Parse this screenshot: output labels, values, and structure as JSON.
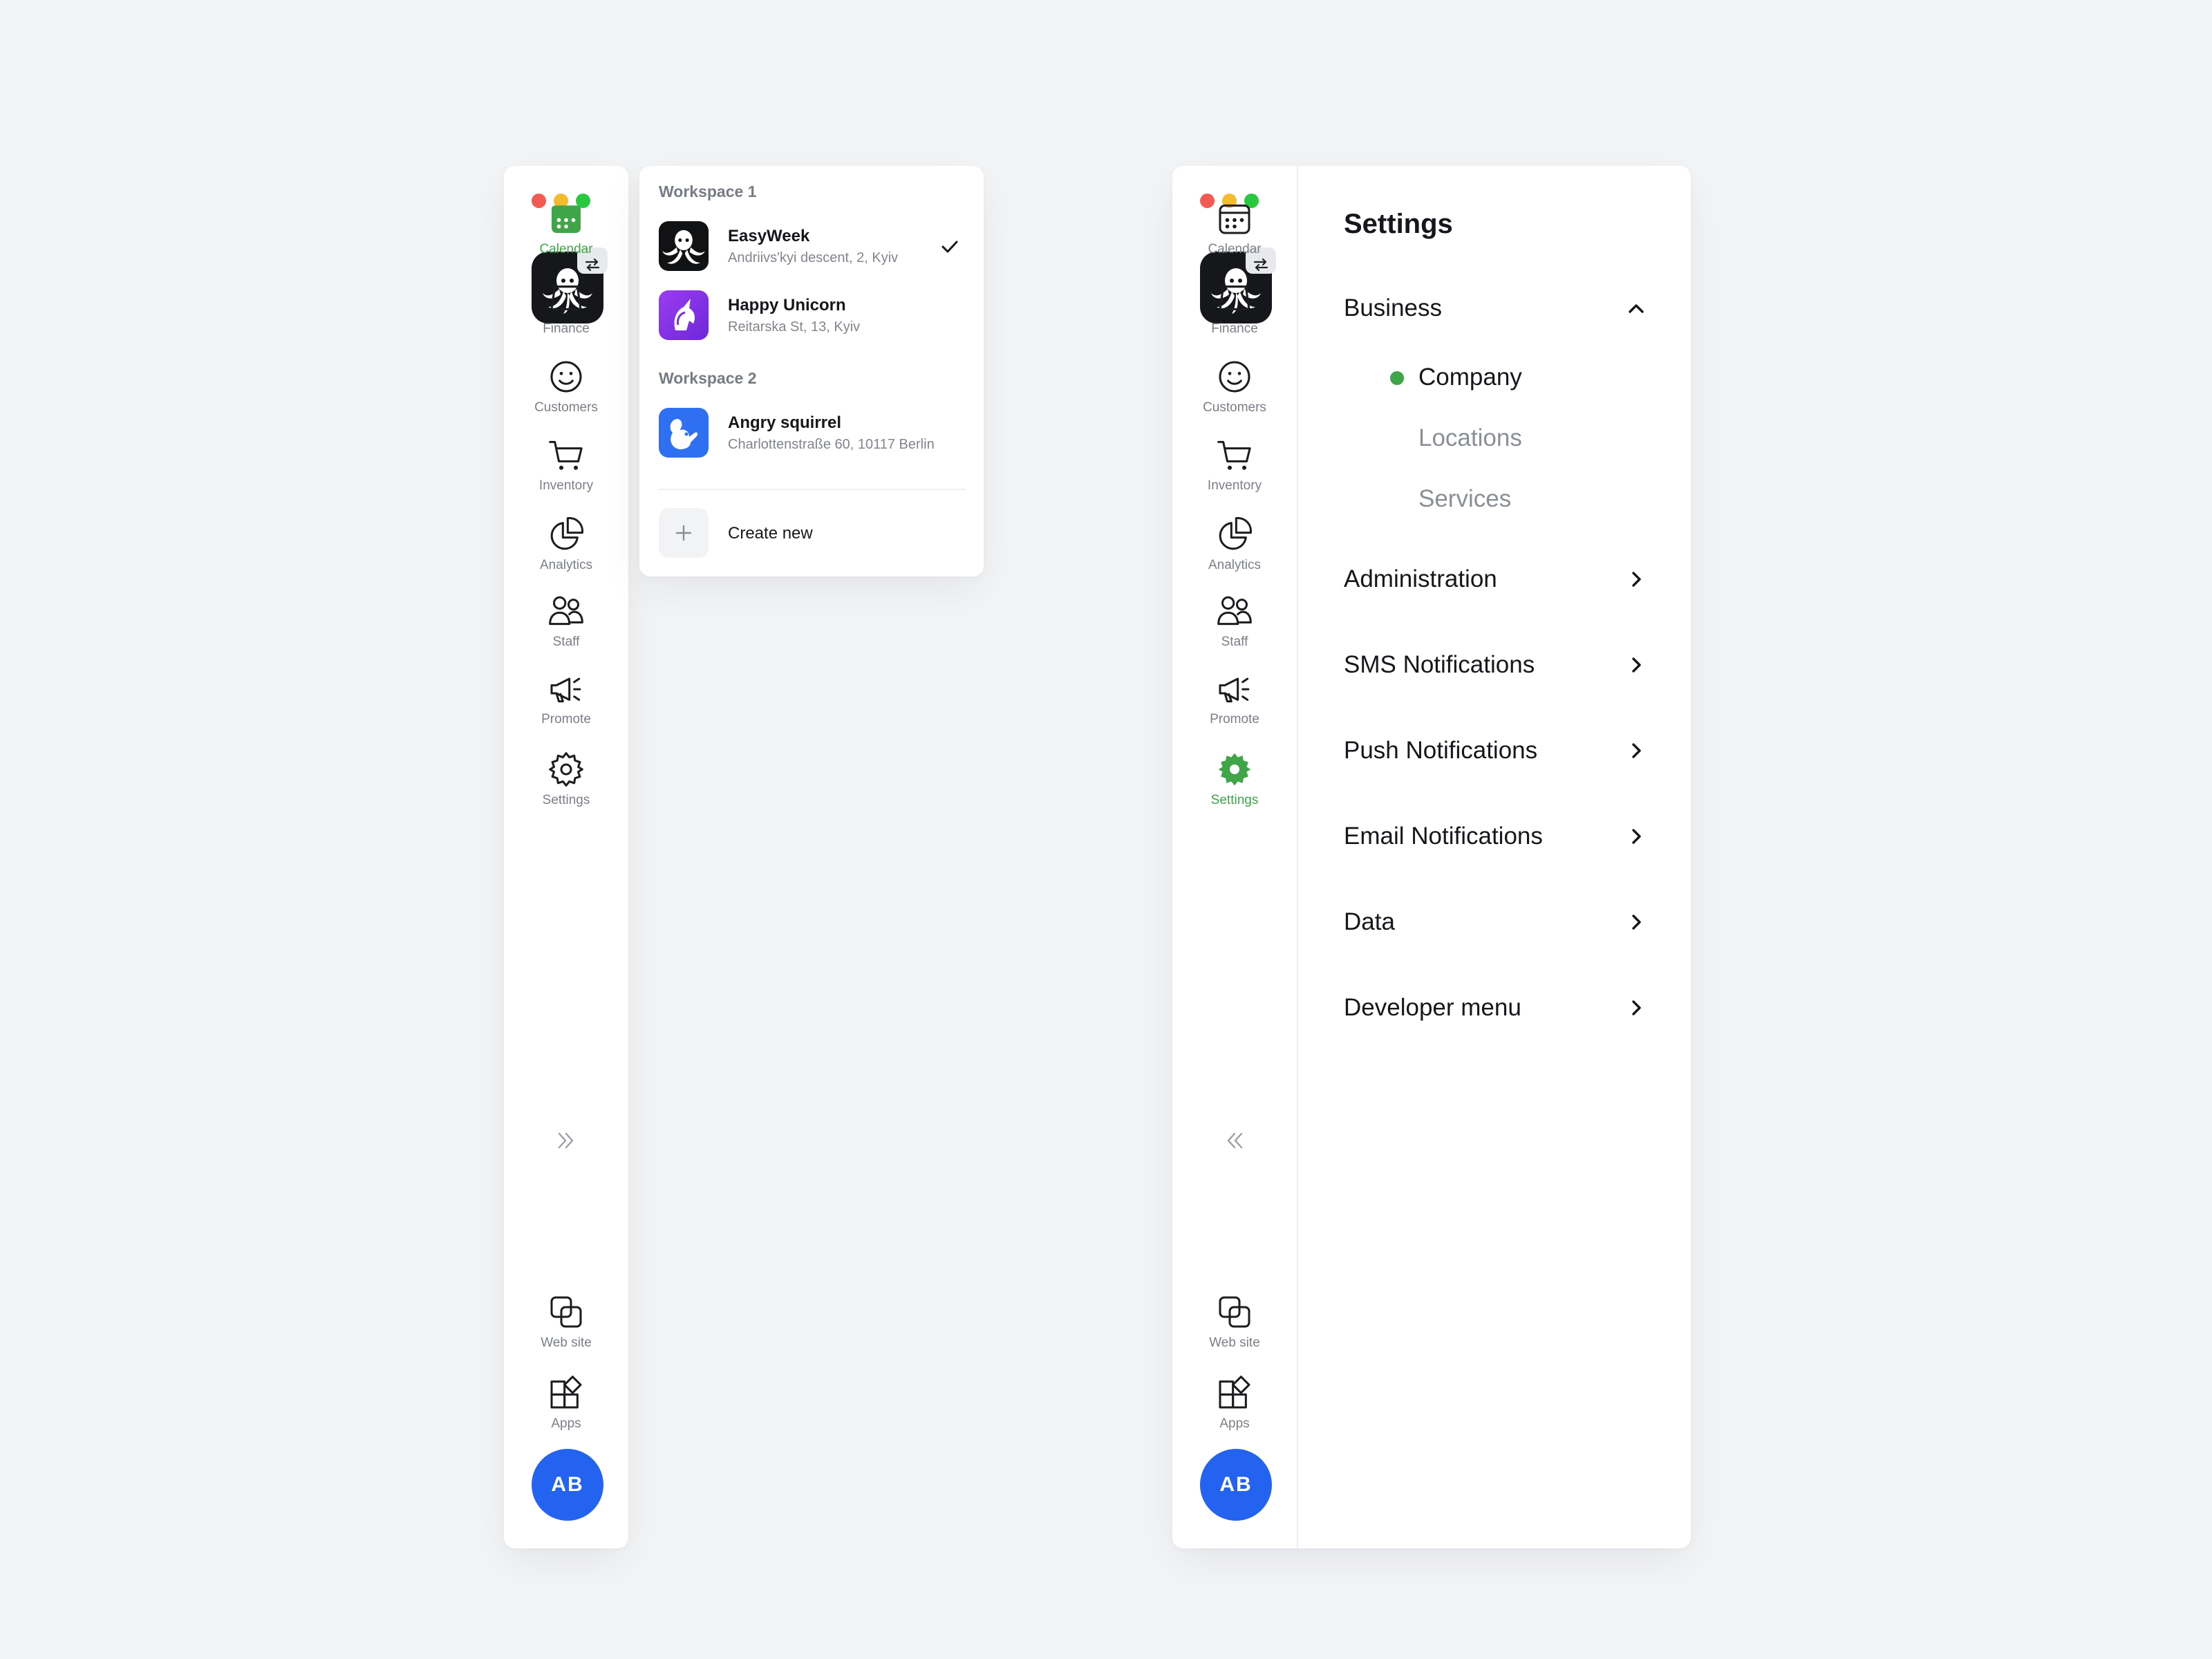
{
  "colors": {
    "accent_green": "#3fa548",
    "avatar_blue": "#2463f0",
    "text_primary": "#15171a",
    "text_muted": "#7a7f87"
  },
  "sidebar": {
    "nav": [
      {
        "id": "calendar",
        "label": "Calendar",
        "icon": "calendar-icon"
      },
      {
        "id": "finance",
        "label": "Finance",
        "icon": "wallet-icon"
      },
      {
        "id": "customers",
        "label": "Customers",
        "icon": "smiley-icon"
      },
      {
        "id": "inventory",
        "label": "Inventory",
        "icon": "cart-icon"
      },
      {
        "id": "analytics",
        "label": "Analytics",
        "icon": "pie-chart-icon"
      },
      {
        "id": "staff",
        "label": "Staff",
        "icon": "people-icon"
      },
      {
        "id": "promote",
        "label": "Promote",
        "icon": "megaphone-icon"
      },
      {
        "id": "settings",
        "label": "Settings",
        "icon": "gear-icon"
      }
    ],
    "bottom": [
      {
        "id": "website",
        "label": "Web site",
        "icon": "link-squares-icon"
      },
      {
        "id": "apps",
        "label": "Apps",
        "icon": "apps-grid-icon"
      }
    ],
    "avatar_initials": "AB",
    "left_active": "Calendar",
    "right_active": "Settings"
  },
  "workspaces": {
    "groups": [
      {
        "heading": "Workspace 1",
        "items": [
          {
            "name": "EasyWeek",
            "address": "Andriivs'kyi descent, 2, Kyiv",
            "icon": "octopus-icon",
            "selected": true
          },
          {
            "name": "Happy Unicorn",
            "address": "Reitarska St, 13, Kyiv",
            "icon": "unicorn-icon",
            "selected": false
          }
        ]
      },
      {
        "heading": "Workspace 2",
        "items": [
          {
            "name": "Angry squirrel",
            "address": "Charlottenstraße 60, 10117 Berlin",
            "icon": "squirrel-icon",
            "selected": false
          }
        ]
      }
    ],
    "create_label": "Create new"
  },
  "settings": {
    "title": "Settings",
    "business": {
      "label": "Business",
      "expanded": true,
      "sub_items": [
        {
          "label": "Company",
          "active": true
        },
        {
          "label": "Locations",
          "active": false
        },
        {
          "label": "Services",
          "active": false
        }
      ]
    },
    "sections": [
      {
        "label": "Administration"
      },
      {
        "label": "SMS Notifications"
      },
      {
        "label": "Push Notifications"
      },
      {
        "label": "Email Notifications"
      },
      {
        "label": "Data"
      },
      {
        "label": "Developer menu"
      }
    ]
  }
}
